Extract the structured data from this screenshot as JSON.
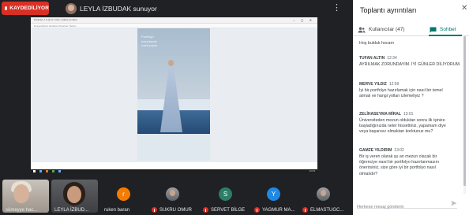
{
  "topbar": {
    "recording_label": "KAYDEDİLİYOR",
    "presenter_title": "LEYLA İZBUDAK sunuyor",
    "more_icon": "more-vert-icon"
  },
  "screen": {
    "window_title": "Portfolyo 1 3 (2) 0 1 2(1) / Adobe Acrobat",
    "window_buttons": "– ▢ ✕",
    "toolbar_hint": "Dosya  Düzen  Görünüm  Pencere  Yardım",
    "doc_heading": "Portfolyo\nhazırlamak\nnasıl yapılır",
    "clock": "12:03"
  },
  "participants": [
    {
      "name": "sümeyye hac...",
      "type": "camera"
    },
    {
      "name": "LEYLA İZBUD...",
      "type": "camera"
    },
    {
      "name": "ruken baran",
      "initial": "r",
      "color": "#f57c00",
      "type": "avatar"
    },
    {
      "name": "SUKRU OMUR",
      "type": "photo"
    },
    {
      "name": "SERVET BİLGE",
      "initial": "S",
      "color": "#2e7d64",
      "type": "avatar"
    },
    {
      "name": "YAGMUR MA...",
      "initial": "Y",
      "color": "#1e88e5",
      "type": "avatar"
    },
    {
      "name": "ELMASTUGC...",
      "type": "photo"
    }
  ],
  "panel": {
    "title": "Toplantı ayrıntıları",
    "close_icon": "close-icon",
    "tabs": {
      "people": "Kullanıcılar (47)",
      "chat": "Sohbet"
    },
    "messages": [
      {
        "sender": "",
        "time": "",
        "text": [
          "Hoş bulduk hocam"
        ]
      },
      {
        "sender": "TUFAN ALTIN",
        "time": "12:34",
        "text": [
          "AYRILMAK ZORUNDAYIM. İYİ GÜNLER DİLİYORUM."
        ]
      },
      {
        "sender": "MERVE YILDIZ",
        "time": "12:59",
        "text": [
          "İyi bir portfolyo  hazırlamak için nasıl bir temel",
          "atmalı ve hangi yolları izlemeliyiz ?"
        ]
      },
      {
        "sender": "ZELİHASEYMA MİRAL",
        "time": "13:01",
        "text": [
          "Üniversiteden mezun olduktan sonra ilk işinize",
          "başladığınızda neler hissettiniz, yapamam diye",
          "veya başarısız olmaktan korktunuz mu?"
        ]
      },
      {
        "sender": "GAMZE YILDIRIM",
        "time": "13:02",
        "text": [
          "Bir iş veren olarak şu an mezun olacak bir",
          "öğrenciye nasıl bir portfolyo hazırlanmasını",
          "önerirsiniz, size göre iyi bir portfolyo nasıl",
          "olmalıdır?"
        ]
      }
    ],
    "composer_placeholder": "Herkese mesaj gönderin"
  }
}
